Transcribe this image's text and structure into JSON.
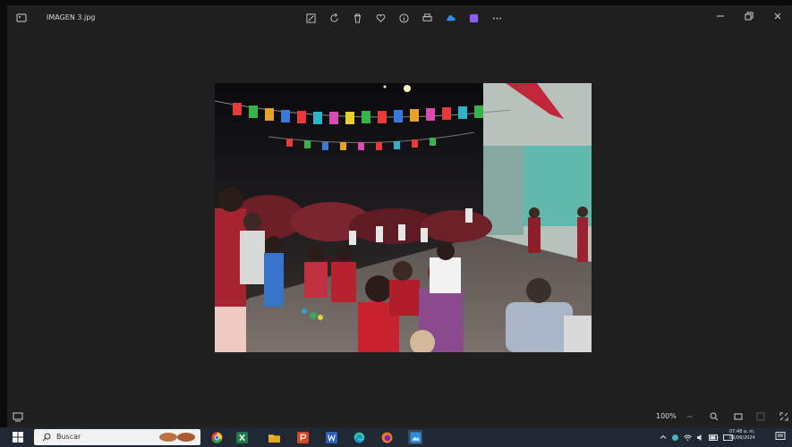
{
  "window": {
    "title": "IMAGEN 3.jpg",
    "toolbar": [
      {
        "name": "edit-image-icon"
      },
      {
        "name": "rotate-icon"
      },
      {
        "name": "delete-icon"
      },
      {
        "name": "favorite-icon"
      },
      {
        "name": "info-icon"
      },
      {
        "name": "print-icon"
      },
      {
        "name": "onedrive-icon"
      },
      {
        "name": "clipchamp-icon"
      },
      {
        "name": "more-options-icon"
      }
    ]
  },
  "viewer": {
    "zoom_level": "100%"
  },
  "taskbar": {
    "search_placeholder": "Buscar",
    "clock_time": "07:48 a. m.",
    "clock_date": "06/06/2024"
  },
  "colors": {
    "window_bg": "#1f1f1f",
    "taskbar_bg": "#202833",
    "accent": "#3aa0ff"
  }
}
